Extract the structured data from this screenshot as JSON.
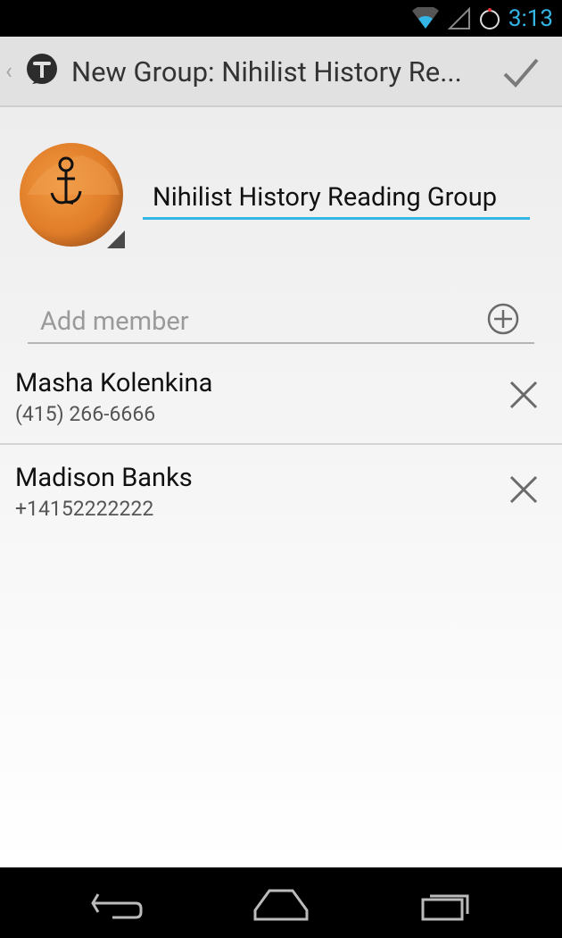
{
  "status_bar": {
    "time": "3:13"
  },
  "action_bar": {
    "title": "New Group: Nihilist History Re..."
  },
  "group": {
    "name": "Nihilist History Reading Group"
  },
  "add_member": {
    "placeholder": "Add member"
  },
  "members": [
    {
      "name": "Masha Kolenkina",
      "number": "(415) 266-6666"
    },
    {
      "name": "Madison Banks",
      "number": "+14152222222"
    }
  ],
  "colors": {
    "accent": "#33b5e5",
    "action_bar": "#e1e1e1"
  },
  "icons": [
    "wifi-icon",
    "signal-icon",
    "alarm-icon",
    "up-caret-icon",
    "app-icon",
    "checkmark-icon",
    "add-circle-icon",
    "close-icon",
    "back-icon",
    "home-icon",
    "recent-apps-icon"
  ]
}
